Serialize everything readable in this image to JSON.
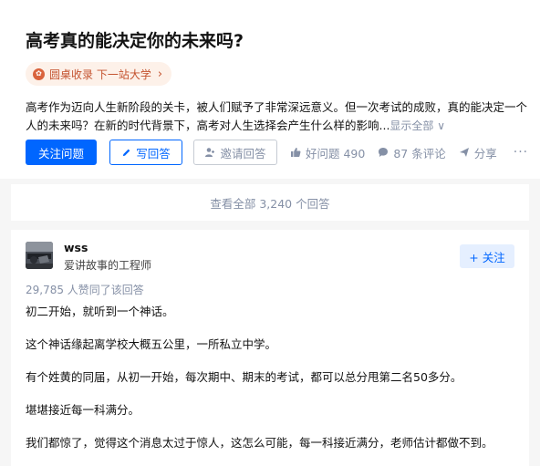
{
  "question": {
    "title": "高考真的能决定你的未来吗?",
    "tag_label": "圆桌收录 下一站大学",
    "description": "高考作为迈向人生新阶段的关卡，被人们赋予了非常深远意义。但一次考试的成败，真的能决定一个人的未来吗？在新的时代背景下，高考对人生选择会产生什么样的影响...",
    "show_all_label": "显示全部 ∨",
    "actions": {
      "follow_label": "关注问题",
      "write_label": "写回答",
      "invite_label": "邀请回答",
      "good_label": "好问题 490",
      "comment_label": "87 条评论",
      "share_label": "分享",
      "more_label": "···"
    }
  },
  "view_all_label": "查看全部 3,240 个回答",
  "answer": {
    "author_name": "wss",
    "author_bio": "爱讲故事的工程师",
    "follow_label": "+ 关注",
    "vote_text": "29,785 人赞同了该回答",
    "paragraphs": [
      "初二开始，就听到一个神话。",
      "这个神话缘起离学校大概五公里，一所私立中学。",
      "有个姓黄的同届，从初一开始，每次期中、期末的考试，都可以总分甩第二名50多分。",
      "堪堪接近每一科满分。",
      "我们都惊了，觉得这个消息太过于惊人，这怎么可能，每一科接近满分，老师估计都做不到。"
    ]
  },
  "colors": {
    "brand_blue": "#0066ff",
    "tag_orange": "#c4532f",
    "muted_gray": "#8590a6"
  },
  "icons": [
    "roundtable-icon",
    "pencil-icon",
    "invite-icon",
    "thumbs-up-icon",
    "comment-icon",
    "share-icon",
    "more-icon",
    "chevron-right-icon"
  ]
}
